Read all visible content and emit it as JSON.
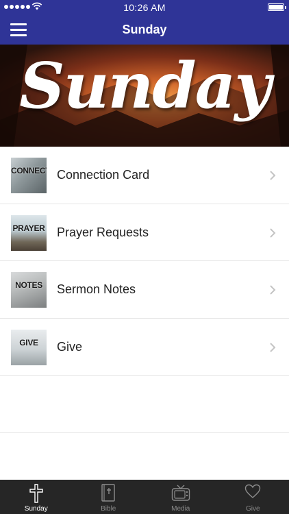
{
  "status_bar": {
    "time": "10:26 AM"
  },
  "header": {
    "title": "Sunday"
  },
  "banner": {
    "text": "Sunday"
  },
  "list": {
    "items": [
      {
        "thumb_text": "CONNECT",
        "label": "Connection Card"
      },
      {
        "thumb_text": "PRAYER",
        "label": "Prayer Requests"
      },
      {
        "thumb_text": "NOTES",
        "label": "Sermon Notes"
      },
      {
        "thumb_text": "GIVE",
        "label": "Give"
      }
    ]
  },
  "tabs": [
    {
      "label": "Sunday",
      "icon": "cross-icon",
      "active": true
    },
    {
      "label": "Bible",
      "icon": "bible-icon",
      "active": false
    },
    {
      "label": "Media",
      "icon": "tv-icon",
      "active": false
    },
    {
      "label": "Give",
      "icon": "heart-icon",
      "active": false
    }
  ],
  "colors": {
    "nav": "#2f3497",
    "tabbar": "#262626"
  }
}
